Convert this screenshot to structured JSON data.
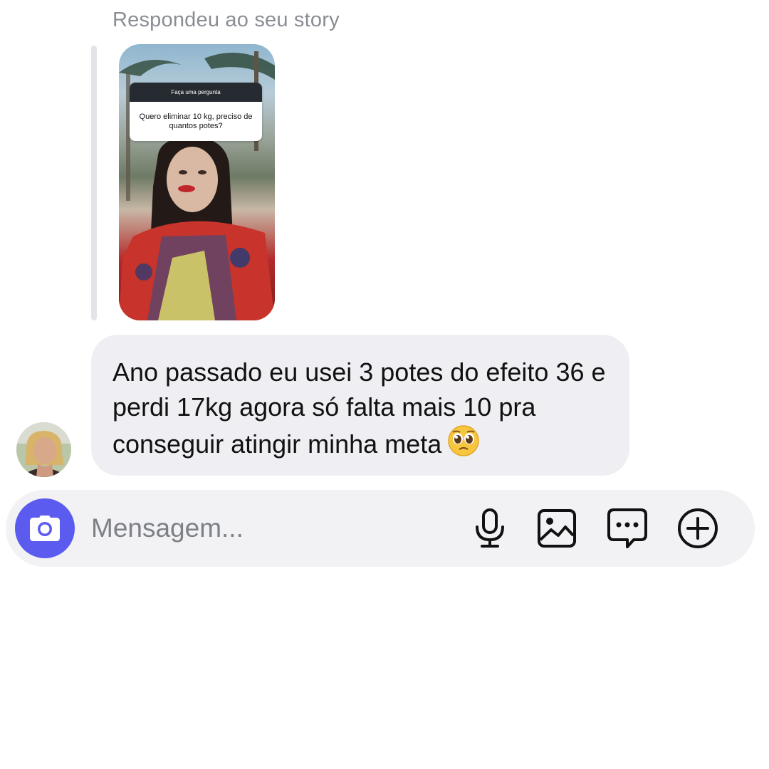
{
  "story_reply": {
    "label": "Respondeu ao seu story",
    "question_box": {
      "header": "Faça uma pergunta",
      "question": "Quero eliminar 10 kg, preciso de quantos potes?"
    }
  },
  "message": {
    "text": "Ano passado eu usei 3 potes do efeito 36 e perdi 17kg agora só falta mais 10 pra conseguir atingir minha meta",
    "emoji": "🥹"
  },
  "composer": {
    "placeholder": "Mensagem...",
    "icons": [
      "camera-icon",
      "microphone-icon",
      "gallery-icon",
      "sticker-chat-icon",
      "plus-circle-icon"
    ]
  },
  "colors": {
    "accent": "#5b5bf0",
    "bubble": "#efeff3",
    "composer": "#f2f2f5",
    "muted_text": "#8a8d93"
  }
}
